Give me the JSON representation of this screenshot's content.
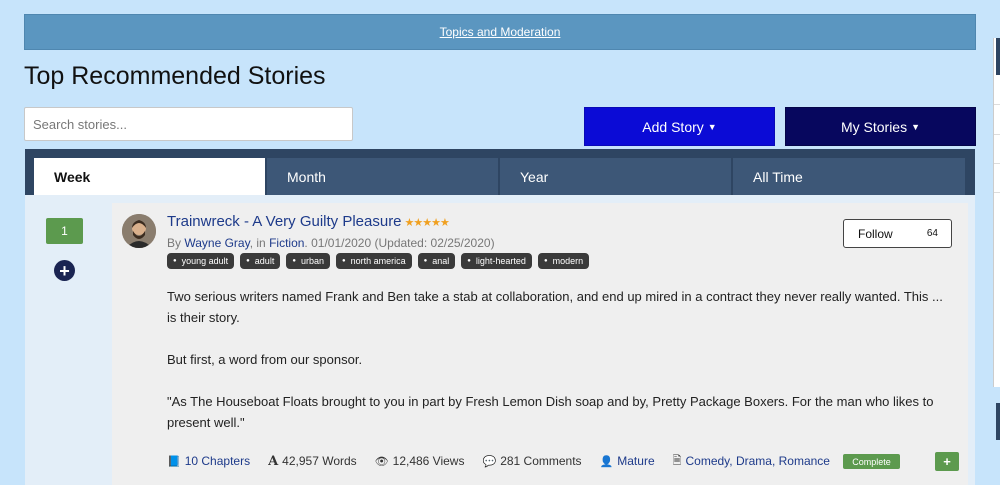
{
  "topbar": {
    "link": "Topics and Moderation"
  },
  "page_title": "Top Recommended Stories",
  "search": {
    "placeholder": "Search stories..."
  },
  "buttons": {
    "add_story": "Add Story",
    "my_stories": "My Stories"
  },
  "tabs": [
    {
      "label": "Week",
      "active": true
    },
    {
      "label": "Month",
      "active": false
    },
    {
      "label": "Year",
      "active": false
    },
    {
      "label": "All Time",
      "active": false
    }
  ],
  "story": {
    "rank": "1",
    "title": "Trainwreck - A Very Guilty Pleasure",
    "stars": "★★★★★",
    "by": "By",
    "author": "Wayne Gray",
    "in": ", in",
    "category": "Fiction",
    "dates": ". 01/01/2020 (Updated: 02/25/2020)",
    "tags": [
      "young adult",
      "adult",
      "urban",
      "north america",
      "anal",
      "light-hearted",
      "modern"
    ],
    "follow_label": "Follow",
    "follow_count": "64",
    "description": [
      "Two serious writers named Frank and Ben take a stab at collaboration, and end up mired in a contract they never really wanted. This ... is their story.",
      "But first, a word from our sponsor.",
      "\"As The Houseboat Floats brought to you in part by Fresh Lemon Dish soap and by, Pretty Package Boxers. For the man who likes to present well.\""
    ],
    "chapters": "10 Chapters",
    "words": "42,957 Words",
    "views": "12,486 Views",
    "comments": "281 Comments",
    "rating": "Mature",
    "genres": "Comedy, Drama, Romance",
    "status": "Complete"
  },
  "colors": {
    "background": "#c7e4fb",
    "topbar": "#5b96c0",
    "add_story_btn": "#0b0bd6",
    "my_stories_btn": "#07075e",
    "tabbar": "#2e4562",
    "accent_green": "#5c9a4e",
    "link": "#1d3a8a",
    "star": "#f0a020"
  },
  "icons": [
    "caret-down-icon",
    "plus-circle-icon",
    "book-icon",
    "font-icon",
    "eye-icon",
    "comment-icon",
    "user-icon",
    "document-icon",
    "plus-icon"
  ]
}
